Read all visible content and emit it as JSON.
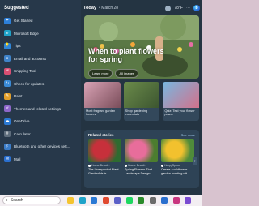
{
  "left_panel": {
    "title": "Suggested",
    "apps": [
      {
        "label": "Get Started",
        "icon": "get-started-icon",
        "color": "#2d7fd9",
        "glyph": "✦"
      },
      {
        "label": "Microsoft Edge",
        "icon": "edge-icon",
        "color": "#1fa3c9",
        "glyph": "e"
      },
      {
        "label": "Tips",
        "icon": "tips-icon",
        "color": "#2f86d8",
        "glyph": "💡"
      },
      {
        "label": "Email and accounts",
        "icon": "person-icon",
        "color": "#3f83c9",
        "glyph": "●"
      },
      {
        "label": "Snipping Tool",
        "icon": "snipping-tool-icon",
        "color": "#d94f73",
        "glyph": "✂"
      },
      {
        "label": "Check for updates",
        "icon": "update-icon",
        "color": "#3a8ad6",
        "glyph": "↻"
      },
      {
        "label": "Paint",
        "icon": "paint-icon",
        "color": "#e3a02b",
        "glyph": "✎"
      },
      {
        "label": "Themes and related settings",
        "icon": "brush-icon",
        "color": "#8e67c9",
        "glyph": "✐"
      },
      {
        "label": "OneDrive",
        "icon": "onedrive-icon",
        "color": "#2a79d4",
        "glyph": "☁"
      },
      {
        "label": "Calculator",
        "icon": "calculator-icon",
        "color": "#5e6d7c",
        "glyph": "#"
      },
      {
        "label": "Bluetooth and other devices sett...",
        "icon": "bluetooth-icon",
        "color": "#3a7cc8",
        "glyph": "ᛒ"
      },
      {
        "label": "Mail",
        "icon": "mail-icon",
        "color": "#2a6fce",
        "glyph": "✉"
      }
    ]
  },
  "feed": {
    "today": "Today",
    "date": "•  March 28",
    "weather": "78°F",
    "more": "⋯",
    "bing": "b",
    "hero": {
      "title": "When to plant flowers for spring",
      "learn_more": "Learn more",
      "all_images": "All images"
    },
    "cards": [
      {
        "caption": "Most fragrant garden flowers",
        "colors": [
          "#d9a3b5",
          "#7a4d5a"
        ]
      },
      {
        "caption": "Shop gardening essentials",
        "colors": [
          "#6b8b4a",
          "#3c5530"
        ]
      },
      {
        "caption": "Quiz: Test your flower power",
        "colors": [
          "#78b7e0",
          "#d3718b"
        ]
      }
    ],
    "related": {
      "title": "Related stories",
      "see_more": "See more",
      "items": [
        {
          "source": "House Beauti...",
          "caption": "The Unexpected Plant Gardenfuls is...",
          "colors": [
            "#c7303b",
            "#2e6b30"
          ]
        },
        {
          "source": "House Beauti...",
          "caption": "Spring Flowers That Landscape Design...",
          "colors": [
            "#e86d9b",
            "#4c7d2f"
          ]
        },
        {
          "source": "HappySprout",
          "caption": "Create a wildflower garden bursting wit...",
          "colors": [
            "#f2c12e",
            "#4f8b3a"
          ]
        }
      ],
      "next": "›"
    }
  },
  "taskbar": {
    "search_placeholder": "Search",
    "search_glyph": "⌕",
    "icons": [
      {
        "name": "file-explorer-icon",
        "color": "#f4c430"
      },
      {
        "name": "edge-taskbar-icon",
        "color": "#1fa3c9"
      },
      {
        "name": "store-icon",
        "color": "#2a79d4"
      },
      {
        "name": "office-icon",
        "color": "#e0492f"
      },
      {
        "name": "teams-icon",
        "color": "#5b5fc7"
      },
      {
        "name": "spotify-icon",
        "color": "#1ed760"
      },
      {
        "name": "xbox-icon",
        "color": "#2a8a2a"
      },
      {
        "name": "settings-icon",
        "color": "#6b6b6b"
      },
      {
        "name": "mail-taskbar-icon",
        "color": "#2a6fce"
      },
      {
        "name": "photos-icon",
        "color": "#c9367f"
      },
      {
        "name": "clipchamp-icon",
        "color": "#7a4bd1"
      }
    ]
  }
}
